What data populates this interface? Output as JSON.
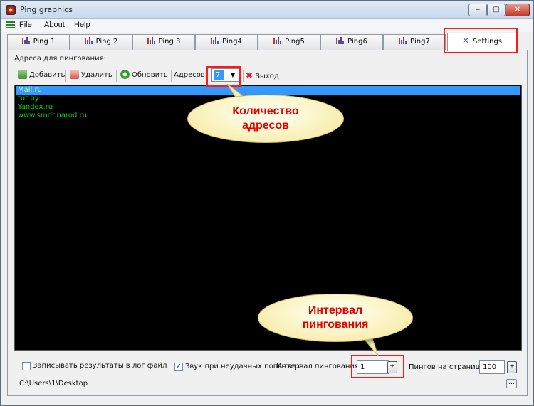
{
  "window": {
    "title": "Ping graphics",
    "controls": {
      "minimize": "‒",
      "maximize": "□",
      "close": "✕"
    }
  },
  "menu": {
    "file": "File",
    "about": "About",
    "help": "Help"
  },
  "tabs": [
    {
      "label": "Ping 1",
      "icon": "bar-chart-icon"
    },
    {
      "label": "Ping 2",
      "icon": "bar-chart-icon"
    },
    {
      "label": "Ping 3",
      "icon": "bar-chart-icon"
    },
    {
      "label": "Ping4",
      "icon": "bar-chart-icon"
    },
    {
      "label": "Ping5",
      "icon": "bar-chart-icon"
    },
    {
      "label": "Ping6",
      "icon": "bar-chart-icon"
    },
    {
      "label": "Ping7",
      "icon": "bar-chart-icon"
    },
    {
      "label": "Settings",
      "icon": "settings-tools-icon",
      "active": true
    }
  ],
  "settings": {
    "group_title": "Адреса для пингования:",
    "toolbar": {
      "add": "Добавить",
      "delete": "Удалить",
      "refresh": "Обновить",
      "address_count_label": "Адресов:",
      "address_count_value": "7",
      "exit": "Выход"
    },
    "addresses": [
      "Mail.ru",
      "tut.by",
      "Yandex.ru",
      "www.smdr.narod.ru"
    ],
    "selected_address_index": 0,
    "log_to_file": {
      "label": "Записывать результаты в лог файл",
      "checked": false
    },
    "sound_on_fail": {
      "label": "Звук при неудачных попытках",
      "checked": true
    },
    "interval_label": "Интервал пингования",
    "interval_value": "1",
    "pings_per_page_label": "Пингов на страницу:",
    "pings_per_page_value": "100",
    "log_path": "C:\\Users\\1\\Desktop",
    "browse_button": "..."
  },
  "annotations": {
    "count_callout": {
      "line1": "Количество",
      "line2": "адресов"
    },
    "interval_callout": {
      "line1": "Интервал",
      "line2": "пингования"
    },
    "highlight_color": "#ff1a1a"
  },
  "colors": {
    "list_background": "#000000",
    "list_text": "#00d800",
    "selection": "#3399ff"
  }
}
